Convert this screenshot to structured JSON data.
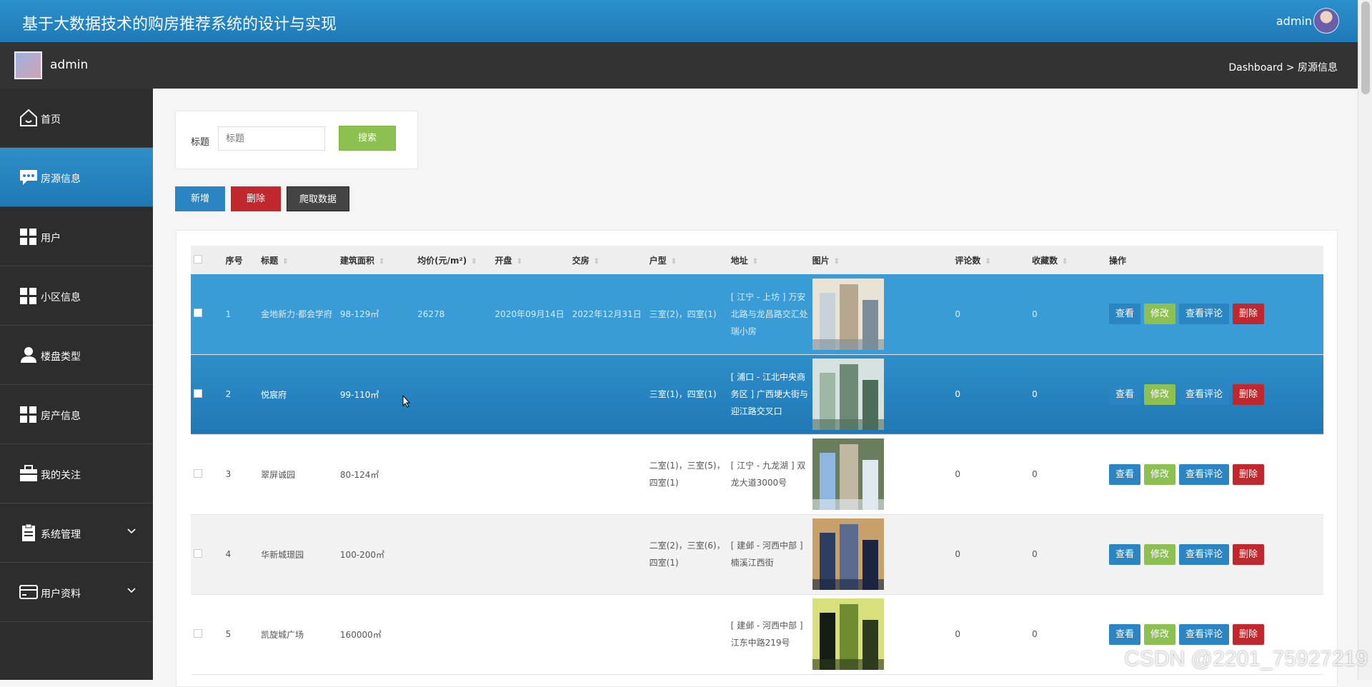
{
  "app_title": "基于大数据技术的购房推荐系统的设计与实现",
  "top_user": "admin",
  "sub_user": "admin",
  "breadcrumb": "Dashboard > 房源信息",
  "sidebar": {
    "items": [
      {
        "label": "首页",
        "icon": "home-icon"
      },
      {
        "label": "房源信息",
        "icon": "chat-icon",
        "active": true
      },
      {
        "label": "用户",
        "icon": "grid-icon"
      },
      {
        "label": "小区信息",
        "icon": "grid-icon"
      },
      {
        "label": "楼盘类型",
        "icon": "user-icon"
      },
      {
        "label": "房产信息",
        "icon": "grid-icon"
      },
      {
        "label": "我的关注",
        "icon": "briefcase-icon"
      },
      {
        "label": "系统管理",
        "icon": "clipboard-icon",
        "expandable": true
      },
      {
        "label": "用户资料",
        "icon": "card-icon",
        "expandable": true
      }
    ]
  },
  "search": {
    "label": "标题",
    "placeholder": "标题",
    "button": "搜索"
  },
  "actions": {
    "add": "新增",
    "delete": "删除",
    "crawl": "爬取数据"
  },
  "table": {
    "headers": [
      "序号",
      "标题",
      "建筑面积",
      "均价(元/m²)",
      "开盘",
      "交房",
      "户型",
      "地址",
      "图片",
      "评论数",
      "收藏数",
      "操作"
    ],
    "sortable": [
      false,
      true,
      true,
      true,
      true,
      true,
      true,
      true,
      true,
      true,
      true,
      false
    ],
    "rows": [
      {
        "no": "1",
        "title": "金地新力·都会学府",
        "area": "98-129㎡",
        "price": "26278",
        "open": "2020年09月14日",
        "deliver": "2022年12月31日",
        "layout": "三室(2)，四室(1)",
        "address": "[ 江宁 - 上坊 ] 万安北路与龙昌路交汇处瑞小房",
        "comments": "0",
        "favorites": "0"
      },
      {
        "no": "2",
        "title": "悦宸府",
        "area": "99-110㎡",
        "price": "",
        "open": "",
        "deliver": "",
        "layout": "三室(1)，四室(1)",
        "address": "[ 浦口 - 江北中央商务区 ] 广西埂大街与迎江路交叉口",
        "comments": "0",
        "favorites": "0"
      },
      {
        "no": "3",
        "title": "翠屏诚园",
        "area": "80-124㎡",
        "price": "",
        "open": "",
        "deliver": "",
        "layout": "二室(1)，三室(5)，四室(1)",
        "address": "[ 江宁 - 九龙湖 ] 双龙大道3000号",
        "comments": "0",
        "favorites": "0"
      },
      {
        "no": "4",
        "title": "华新城璟园",
        "area": "100-200㎡",
        "price": "",
        "open": "",
        "deliver": "",
        "layout": "二室(2)，三室(6)，四室(1)",
        "address": "[ 建邺 - 河西中部 ] 楠溪江西街",
        "comments": "0",
        "favorites": "0"
      },
      {
        "no": "5",
        "title": "凯旋城广场",
        "area": "160000㎡",
        "price": "",
        "open": "",
        "deliver": "",
        "layout": "",
        "address": "[ 建邺 - 河西中部 ] 江东中路219号",
        "comments": "0",
        "favorites": "0"
      }
    ],
    "row_buttons": {
      "view": "查看",
      "edit": "修改",
      "comments": "查看评论",
      "delete": "删除"
    }
  },
  "watermark": "CSDN @2201_75927219",
  "colors": {
    "primary": "#2b85c2",
    "success": "#8cc152",
    "danger": "#c0282d",
    "sidebar": "#2d2d2d"
  }
}
